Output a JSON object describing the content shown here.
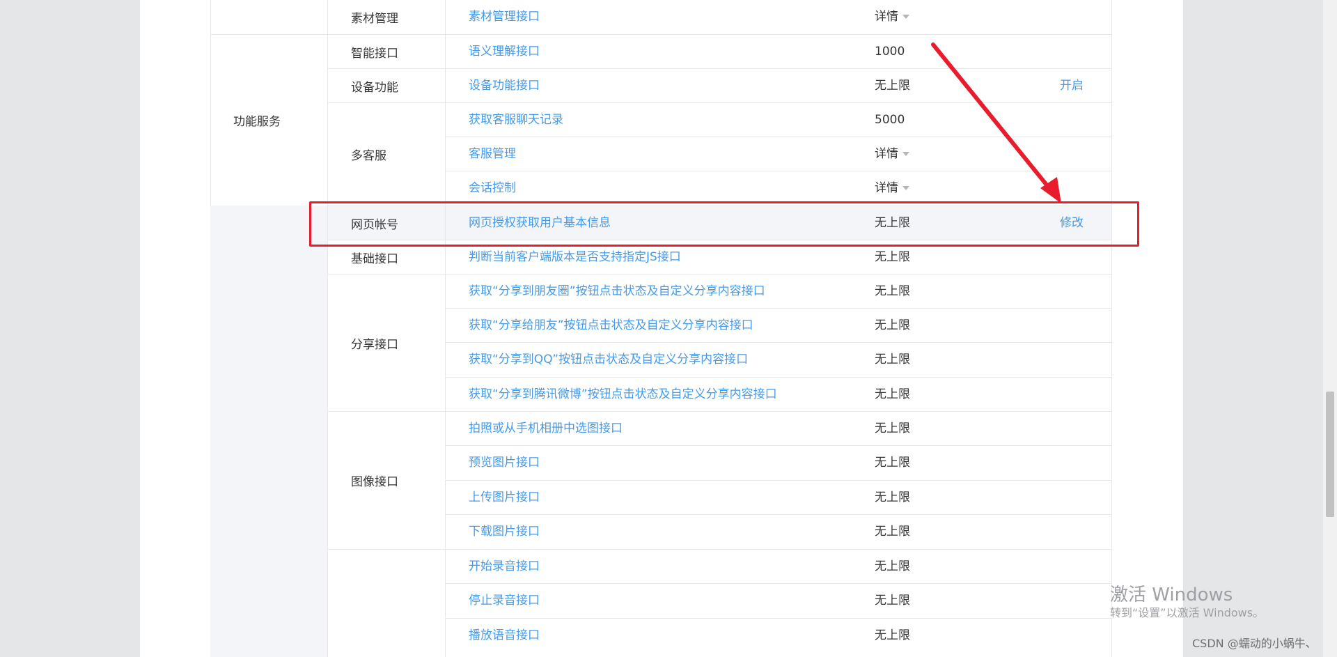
{
  "categories": [
    {
      "label": "功能服务"
    }
  ],
  "subcategories": [
    {
      "label": "素材管理"
    },
    {
      "label": "智能接口"
    },
    {
      "label": "设备功能"
    },
    {
      "label": "多客服"
    },
    {
      "label": "网页帐号"
    },
    {
      "label": "基础接口"
    },
    {
      "label": "分享接口"
    },
    {
      "label": "图像接口"
    }
  ],
  "rows": [
    {
      "name": "素材管理接口",
      "limit": "详情",
      "op": ""
    },
    {
      "name": "语义理解接口",
      "limit": "1000",
      "op": ""
    },
    {
      "name": "设备功能接口",
      "limit": "无上限",
      "op": "开启"
    },
    {
      "name": "获取客服聊天记录",
      "limit": "5000",
      "op": ""
    },
    {
      "name": "客服管理",
      "limit": "详情",
      "op": ""
    },
    {
      "name": "会话控制",
      "limit": "详情",
      "op": ""
    },
    {
      "name": "网页授权获取用户基本信息",
      "limit": "无上限",
      "op": "修改"
    },
    {
      "name": "判断当前客户端版本是否支持指定JS接口",
      "limit": "无上限",
      "op": ""
    },
    {
      "name": "获取“分享到朋友圈”按钮点击状态及自定义分享内容接口",
      "limit": "无上限",
      "op": ""
    },
    {
      "name": "获取“分享给朋友”按钮点击状态及自定义分享内容接口",
      "limit": "无上限",
      "op": ""
    },
    {
      "name": "获取“分享到QQ”按钮点击状态及自定义分享内容接口",
      "limit": "无上限",
      "op": ""
    },
    {
      "name": "获取“分享到腾讯微博”按钮点击状态及自定义分享内容接口",
      "limit": "无上限",
      "op": ""
    },
    {
      "name": "拍照或从手机相册中选图接口",
      "limit": "无上限",
      "op": ""
    },
    {
      "name": "预览图片接口",
      "limit": "无上限",
      "op": ""
    },
    {
      "name": "上传图片接口",
      "limit": "无上限",
      "op": ""
    },
    {
      "name": "下载图片接口",
      "limit": "无上限",
      "op": ""
    },
    {
      "name": "开始录音接口",
      "limit": "无上限",
      "op": ""
    },
    {
      "name": "停止录音接口",
      "limit": "无上限",
      "op": ""
    },
    {
      "name": "播放语音接口",
      "limit": "无上限",
      "op": ""
    }
  ],
  "watermark": {
    "line1": "激活 Windows",
    "line2": "转到“设置”以激活 Windows。"
  },
  "csdn": "CSDN @蠕动的小蜗牛、",
  "colors": {
    "link": "#459ae9",
    "annotation": "#e81c2d",
    "highlight_row": "#f4f5f9"
  }
}
